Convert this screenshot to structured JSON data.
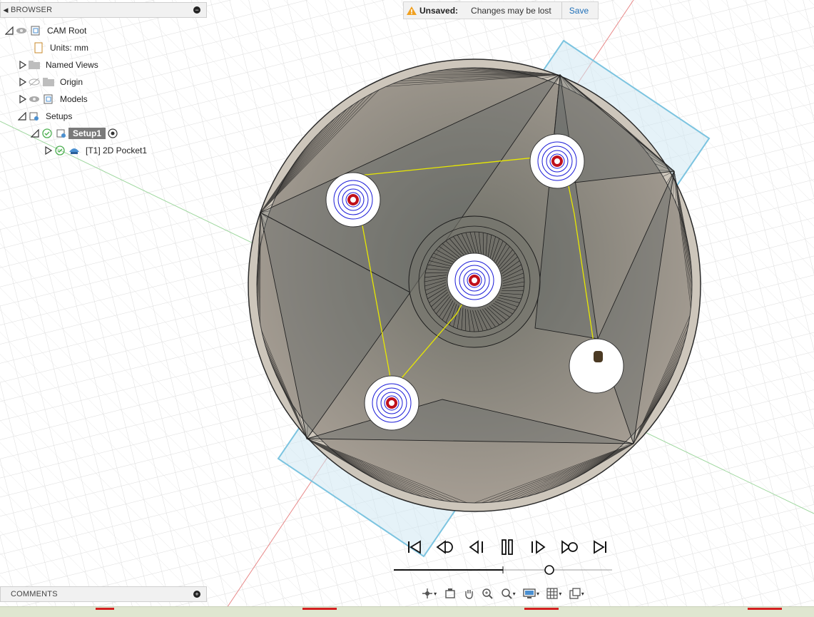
{
  "browser": {
    "title": "BROWSER",
    "tree": [
      {
        "label": "CAM Root"
      },
      {
        "label": "Units: mm"
      },
      {
        "label": "Named Views"
      },
      {
        "label": "Origin"
      },
      {
        "label": "Models"
      },
      {
        "label": "Setups"
      },
      {
        "label": "Setup1"
      },
      {
        "label": "[T1] 2D Pocket1"
      }
    ]
  },
  "banner": {
    "status": "Unsaved:",
    "message": "Changes may be lost",
    "save_label": "Save"
  },
  "comments": {
    "title": "COMMENTS"
  },
  "simulation": {
    "position_fraction": 0.71
  },
  "colors": {
    "toolpath": "#1a1ad8",
    "rapid": "#e8e800",
    "stock_plane": "#7cc4e0",
    "part": "#8f8b83",
    "accent": "#1f6fb8",
    "warning": "#f0a020"
  },
  "icons": [
    "eye-icon",
    "eye-hidden-icon",
    "folder-icon",
    "document-icon",
    "setup-icon",
    "check-icon",
    "target-icon",
    "operation-icon",
    "warning-icon",
    "orbit-icon",
    "pan-icon",
    "zoom-icon",
    "display-settings-icon",
    "grid-icon",
    "viewports-icon"
  ]
}
